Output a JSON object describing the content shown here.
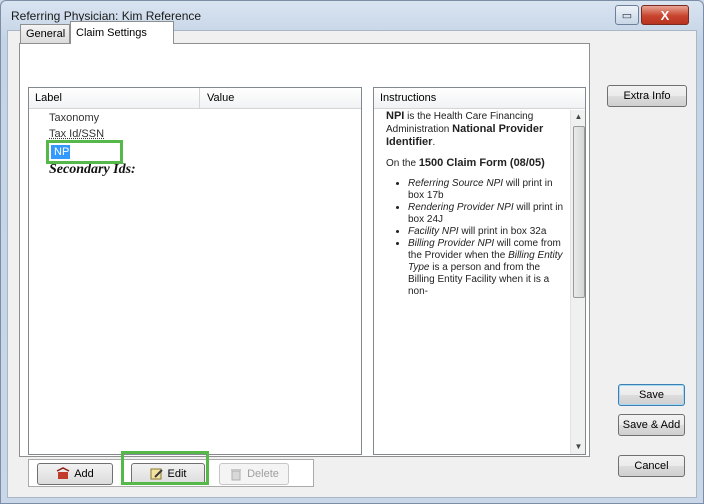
{
  "window": {
    "title": "Referring Physician: Kim Reference",
    "minimize_label": "▭",
    "close_label": "X"
  },
  "tabs": [
    {
      "label": "General",
      "active": false
    },
    {
      "label": "Claim Settings",
      "active": true
    }
  ],
  "grid": {
    "columns": {
      "label": "Label",
      "value": "Value"
    },
    "rows": [
      {
        "label": "Taxonomy",
        "value": ""
      },
      {
        "label": "Tax Id/SSN",
        "value": ""
      },
      {
        "label": "NPI",
        "value": "",
        "selected": true
      },
      {
        "label": "Secondary Ids:",
        "value": ""
      }
    ]
  },
  "instructions": {
    "header": "Instructions",
    "p1_bold": "NPI",
    "p1_text": " is the Health Care Financing Administration ",
    "p1_bold2": "National Provider Identifier",
    "p1_end": ".",
    "p2_pre": "On the ",
    "p2_bold": "1500 Claim Form (08/05)",
    "items": [
      {
        "em": "Referring Source NPI",
        "text": " will print in box 17b"
      },
      {
        "em": "Rendering Provider NPI",
        "text": " will print in box 24J"
      },
      {
        "em": "Facility NPI",
        "text": " will print in box 32a"
      },
      {
        "em": "Billing Provider NPI",
        "text": " will come from the Provider when the ",
        "em2": "Billing Entity Type",
        "text2": " is a person and from the Billing Entity Facility when it is a non-"
      }
    ]
  },
  "buttons": {
    "extra_info": "Extra Info",
    "save": "Save",
    "save_add": "Save & Add",
    "cancel": "Cancel",
    "add": "Add",
    "edit": "Edit",
    "delete": "Delete"
  },
  "colors": {
    "highlight": "#54b948",
    "selection": "#3399ff"
  }
}
